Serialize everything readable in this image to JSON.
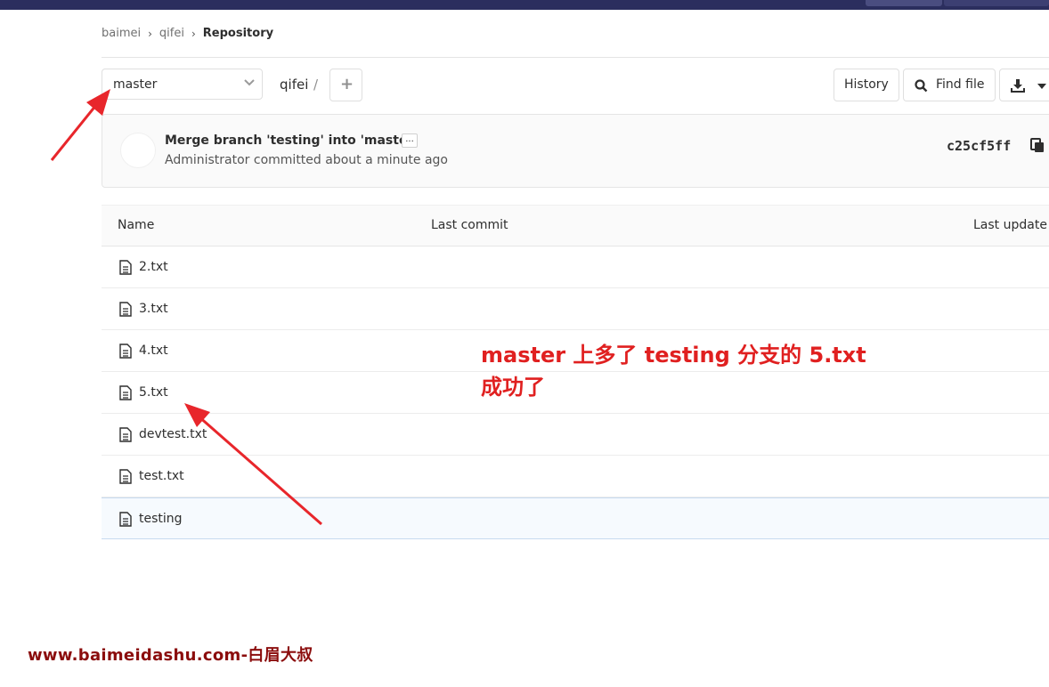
{
  "breadcrumb": [
    "baimei",
    "qifei",
    "Repository"
  ],
  "branch": {
    "selected": "master"
  },
  "path": {
    "root": "qifei",
    "separator": "/"
  },
  "toolbar": {
    "history_label": "History",
    "find_file_label": "Find file"
  },
  "commit": {
    "title": "Merge branch 'testing' into 'master'",
    "ellipsis": "...",
    "meta": "Administrator committed about a minute ago",
    "sha": "c25cf5ff"
  },
  "table": {
    "headers": [
      "Name",
      "Last commit",
      "Last update"
    ],
    "files": [
      "2.txt",
      "3.txt",
      "4.txt",
      "5.txt",
      "devtest.txt",
      "test.txt",
      "testing"
    ]
  },
  "annotation": {
    "line1": "master 上多了 testing 分支的 5.txt",
    "line2": "成功了",
    "color": "#e02020"
  },
  "watermark": "www.baimeidashu.com-白眉大叔",
  "icons": [
    "chevron-down-icon",
    "plus-icon",
    "search-icon",
    "download-icon",
    "copy-icon",
    "file-icon",
    "arrow-icon"
  ]
}
